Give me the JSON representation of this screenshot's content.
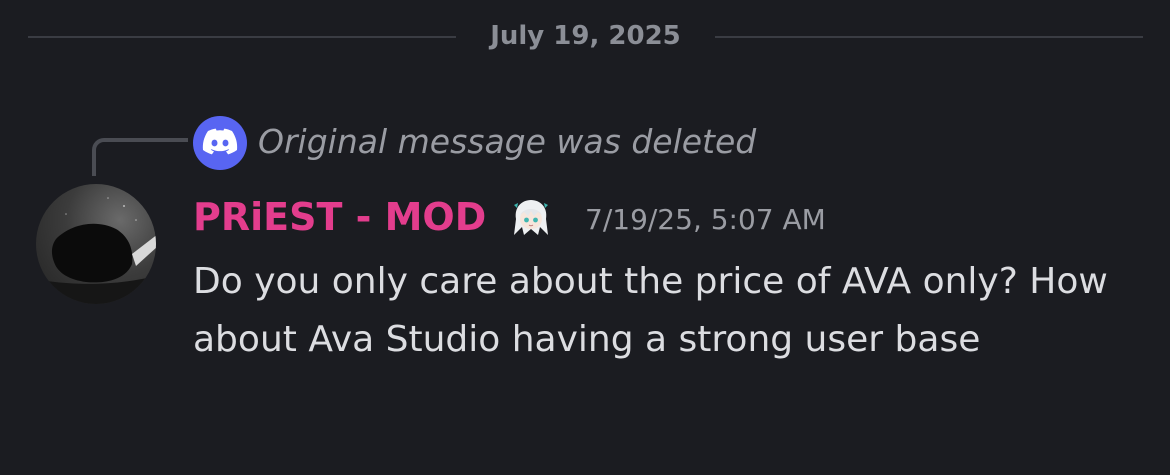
{
  "divider": {
    "date": "July 19, 2025"
  },
  "reply": {
    "icon": "discord-logo-icon",
    "text": "Original message was deleted"
  },
  "message": {
    "author": "PRiEST - MOD",
    "author_color": "#e33d8d",
    "role_icon": "anime-character-emoji-icon",
    "timestamp": "7/19/25, 5:07 AM",
    "content": "Do you only care about the price of AVA only? How about Ava Studio having a strong user base"
  },
  "colors": {
    "background": "#1b1c21",
    "discord_blurple": "#5865f2",
    "muted_text": "#9a9ca3",
    "divider": "#3a3c43"
  }
}
